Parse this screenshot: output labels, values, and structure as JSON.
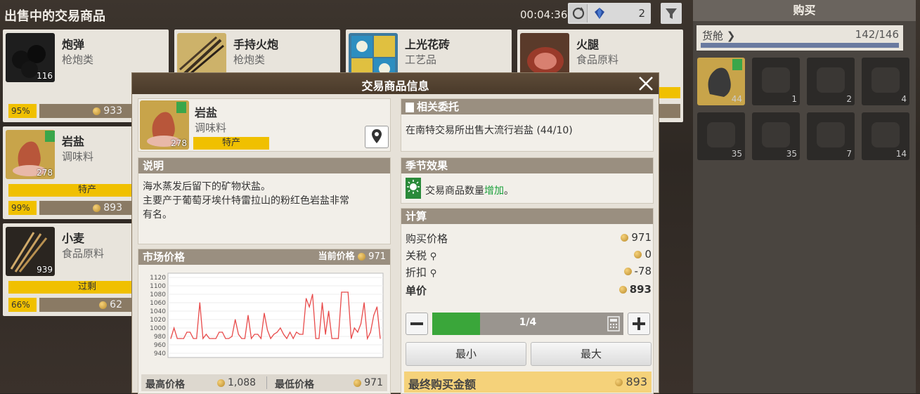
{
  "header": {
    "title": "出售中的交易商品",
    "timer": "00:04:36",
    "gem_count": "2"
  },
  "goods": [
    {
      "name": "炮弹",
      "category": "枪炮类",
      "count": "116",
      "pct": "95%",
      "price": "933",
      "tag": ""
    },
    {
      "name": "手持火炮",
      "category": "枪炮类",
      "count": "",
      "pct": "",
      "price": "",
      "tag": ""
    },
    {
      "name": "上光花砖",
      "category": "工艺品",
      "count": "",
      "pct": "",
      "price": "",
      "tag": ""
    },
    {
      "name": "火腿",
      "category": "食品原料",
      "count": "",
      "pct": "",
      "price": "",
      "tag": ""
    },
    {
      "name": "岩盐",
      "category": "调味料",
      "count": "278",
      "pct": "99%",
      "price": "893",
      "tag": "特产"
    },
    {
      "name": "小麦",
      "category": "食品原料",
      "count": "939",
      "pct": "66%",
      "price": "62",
      "tag": "过剩"
    }
  ],
  "buy": {
    "title": "购买",
    "cargo_label": "货舱 ❯",
    "cargo_count": "142/146",
    "slots": [
      "44",
      "1",
      "2",
      "4",
      "35",
      "35",
      "7",
      "14"
    ]
  },
  "modal": {
    "title": "交易商品信息",
    "item": {
      "name": "岩盐",
      "category": "调味料",
      "count": "278",
      "tag": "特产"
    },
    "desc": {
      "title": "说明",
      "lines": [
        "海水蒸发后留下的矿物状盐。",
        "主要产于葡萄牙埃什特雷拉山的粉红色岩盐非常",
        "有名。"
      ]
    },
    "market": {
      "title": "市场价格",
      "current_label": "当前价格",
      "current": "971",
      "max_label": "最高价格",
      "max": "1,088",
      "min_label": "最低价格",
      "min": "971"
    },
    "commission": {
      "title": "相关委托",
      "text": "在南特交易所出售大流行岩盐 (44/10)"
    },
    "season": {
      "title": "季节效果",
      "text": "交易商品数量",
      "effect": "增加",
      "suffix": "。"
    },
    "calc": {
      "title": "计算",
      "rows": [
        {
          "label": "购买价格",
          "value": "971"
        },
        {
          "label": "关税",
          "value": "0"
        },
        {
          "label": "折扣",
          "value": "-78"
        },
        {
          "label": "单价",
          "value": "893"
        }
      ]
    },
    "qty": "1/4",
    "qty_fraction": 0.25,
    "min_label": "最小",
    "max_label": "最大",
    "final_label": "最终购买金额",
    "final_value": "893"
  },
  "chart_data": {
    "type": "line",
    "ylim": [
      930,
      1130
    ],
    "yticks": [
      "1120",
      "1100",
      "1080",
      "1060",
      "1040",
      "1020",
      "1000",
      "980",
      "960",
      "940"
    ],
    "series": [
      {
        "values": [
          975,
          1000,
          975,
          975,
          975,
          990,
          990,
          975,
          975,
          1060,
          975,
          985,
          975,
          975,
          975,
          990,
          990,
          975,
          975,
          980,
          1020,
          985,
          975,
          975,
          1030,
          975,
          985,
          985,
          975,
          1035,
          995,
          975,
          985,
          990,
          1000,
          985,
          975,
          990,
          975,
          990,
          985,
          985,
          1070,
          1050,
          1080,
          975,
          975,
          1060,
          985,
          1040,
          975,
          975,
          975,
          1085,
          1085,
          1085,
          975,
          1000,
          990,
          1010,
          1060,
          975,
          990,
          1030,
          1050,
          975
        ]
      }
    ]
  }
}
